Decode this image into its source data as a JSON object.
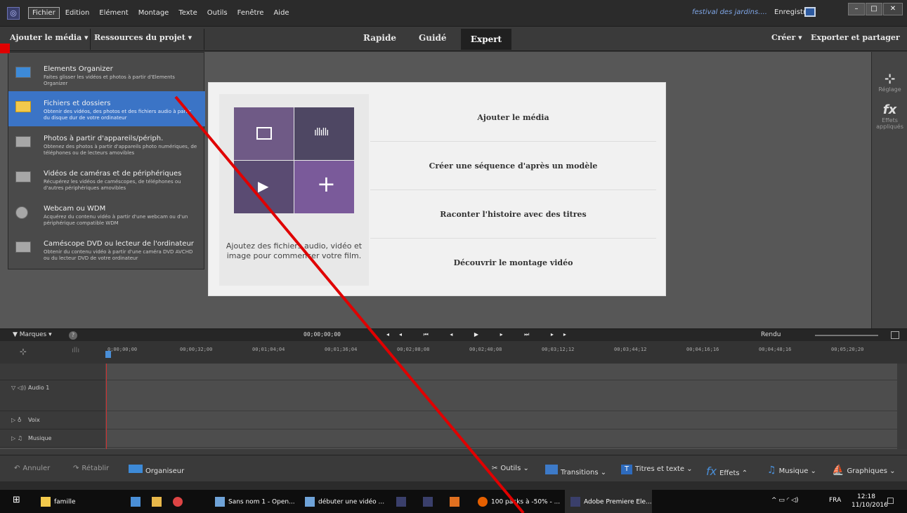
{
  "menu": {
    "items": [
      "Fichier",
      "Edition",
      "Elément",
      "Montage",
      "Texte",
      "Outils",
      "Fenêtre",
      "Aide"
    ],
    "project_title": "festival des jardins....",
    "save_label": "Enregistrer"
  },
  "modebar": {
    "add_media": "Ajouter le média ▾",
    "resources": "Ressources du projet ▾",
    "modes": [
      "Rapide",
      "Guidé",
      "Expert"
    ],
    "create": "Créer ▾",
    "export": "Exporter et partager"
  },
  "right_panel": {
    "adjust_label": "Réglage",
    "effects_label": "Effets appliqués"
  },
  "dropdown": {
    "items": [
      {
        "title": "Elements Organizer",
        "desc": "Faites glisser les vidéos et photos à partir d'Elements Organizer"
      },
      {
        "title": "Fichiers et dossiers",
        "desc": "Obtenir des vidéos, des photos et des fichiers audio à partir du disque dur de votre ordinateur"
      },
      {
        "title": "Photos à partir d'appareils/périph.",
        "desc": "Obtenez des photos à partir d'appareils photo numériques, de téléphones ou de lecteurs amovibles"
      },
      {
        "title": "Vidéos de caméras et de périphériques",
        "desc": "Récupérez les vidéos de caméscopes, de téléphones ou d'autres périphériques amovibles"
      },
      {
        "title": "Webcam ou WDM",
        "desc": "Acquérez du contenu vidéo à partir d'une webcam ou d'un périphérique compatible WDM"
      },
      {
        "title": "Caméscope DVD ou lecteur de l'ordinateur",
        "desc": "Obtenir du contenu vidéo à partir d'une caméra DVD AVCHD ou du lecteur DVD de votre ordinateur"
      }
    ]
  },
  "welcome": {
    "caption": "Ajoutez des fichiers audio, vidéo et image pour commencer votre film.",
    "options": [
      "Ajouter le média",
      "Créer une séquence d'après un modèle",
      "Raconter l'histoire avec des titres",
      "Découvrir le montage vidéo"
    ]
  },
  "timebar": {
    "markers": "▼ Marques ▾",
    "timecode": "00;00;00;00",
    "render": "Rendu"
  },
  "ruler": {
    "ticks": [
      "0;00;00;00",
      "00;00;32;00",
      "00;01;04;04",
      "00;01;36;04",
      "00;02;08;08",
      "00;02;40;08",
      "00;03;12;12",
      "00;03;44;12",
      "00;04;16;16",
      "00;04;48;16",
      "00;05;20;20"
    ]
  },
  "tracks": [
    "Audio 1",
    "Voix",
    "Musique"
  ],
  "bottom": {
    "undo": "Annuler",
    "redo": "Rétablir",
    "organizer": "Organiseur",
    "tools": "Outils ⌄",
    "transitions": "Transitions ⌄",
    "titles": "Titres et texte ⌄",
    "effects": "Effets ⌃",
    "music": "Musique ⌄",
    "graphics": "Graphiques ⌄"
  },
  "taskbar": {
    "items": [
      "famille",
      "Sans nom 1 - Open...",
      "débuter une vidéo ...",
      "100 packs à -50% - ...",
      "Adobe Premiere Ele..."
    ],
    "lang": "FRA",
    "time": "12:18",
    "date": "11/10/2016"
  },
  "colors": {
    "accent": "#3b74c6",
    "expert": "#202020",
    "purple": "#6e4f8c",
    "annotation": "#e00000"
  }
}
